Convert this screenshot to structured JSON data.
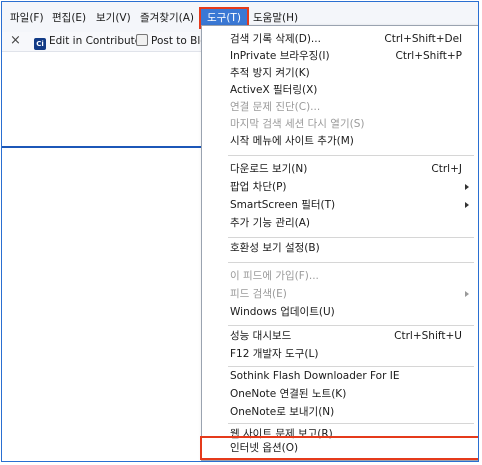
{
  "menubar": {
    "items": [
      {
        "label": "파일(F)"
      },
      {
        "label": "편집(E)"
      },
      {
        "label": "보기(V)"
      },
      {
        "label": "즐겨찾기(A)"
      },
      {
        "label": "도구(T)"
      },
      {
        "label": "도움말(H)"
      }
    ],
    "active_item": "도구(T)"
  },
  "favorites_bar": {
    "close_symbol": "×",
    "edit_in_contribute": "Edit in Contribute",
    "edit_icon_text": "Ci",
    "post_to_blog": "Post to Blog"
  },
  "tools_menu": {
    "items": [
      {
        "label": "검색 기록 삭제(D)...",
        "shortcut": "Ctrl+Shift+Del"
      },
      {
        "label": "InPrivate 브라우징(I)",
        "shortcut": "Ctrl+Shift+P"
      },
      {
        "label": "추적 방지 켜기(K)"
      },
      {
        "label": "ActiveX 필터링(X)"
      },
      {
        "label": "연결 문제 진단(C)...",
        "disabled": true
      },
      {
        "label": "마지막 검색 세션 다시 열기(S)",
        "disabled": true
      },
      {
        "label": "시작 메뉴에 사이트 추가(M)"
      },
      {
        "label": "다운로드 보기(N)",
        "shortcut": "Ctrl+J"
      },
      {
        "label": "팝업 차단(P)",
        "submenu": true
      },
      {
        "label": "SmartScreen 필터(T)",
        "submenu": true
      },
      {
        "label": "추가 기능 관리(A)"
      },
      {
        "label": "호환성 보기 설정(B)"
      },
      {
        "label": "이 피드에 가입(F)...",
        "disabled": true
      },
      {
        "label": "피드 검색(E)",
        "disabled": true,
        "submenu": true
      },
      {
        "label": "Windows 업데이트(U)"
      },
      {
        "label": "성능 대시보드",
        "shortcut": "Ctrl+Shift+U"
      },
      {
        "label": "F12 개발자 도구(L)"
      },
      {
        "label": "Sothink Flash Downloader For IE"
      },
      {
        "label": "OneNote 연결된 노트(K)"
      },
      {
        "label": "OneNote로 보내기(N)"
      },
      {
        "label": "웹 사이트 문제 보고(R)"
      },
      {
        "label": "인터넷 옵션(O)"
      }
    ],
    "highlighted_item": "인터넷 옵션(O)"
  },
  "colors": {
    "active_menu_bg": "#3a78d4",
    "highlight_border": "#e53a1b",
    "frame_border": "#2a6fd1"
  }
}
